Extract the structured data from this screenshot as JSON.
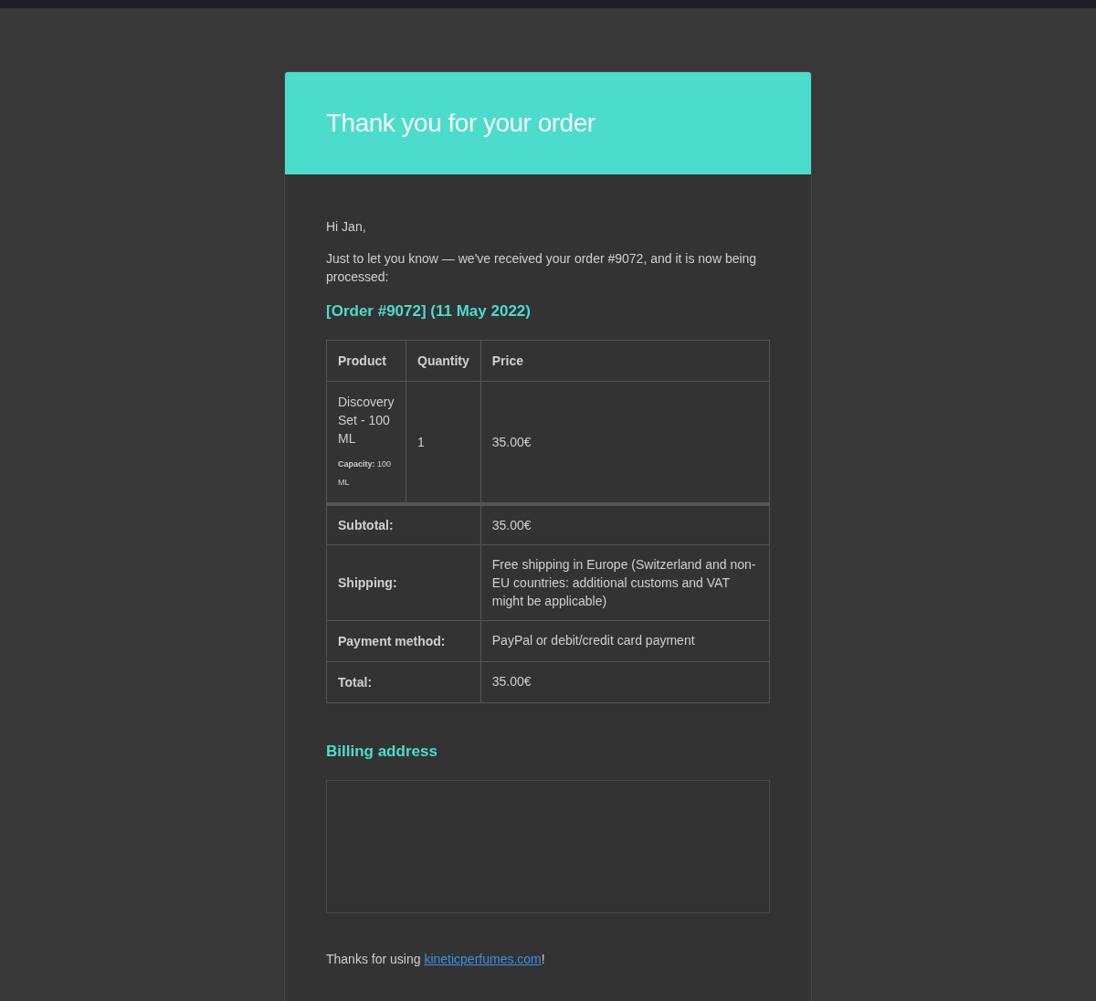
{
  "header": {
    "title": "Thank you for your order"
  },
  "greeting": "Hi Jan,",
  "intro": "Just to let you know — we've received your order #9072, and it is now being processed:",
  "order_heading": "[Order #9072] (11 May 2022)",
  "order_table": {
    "columns": [
      "Product",
      "Quantity",
      "Price"
    ],
    "items": [
      {
        "product": "Discovery Set - 100 ML",
        "meta": "**Capacity:** 100 ML",
        "quantity": "1",
        "price": "35.00€"
      }
    ],
    "totals": [
      {
        "label": "Subtotal:",
        "value": "35.00€"
      },
      {
        "label": "Shipping:",
        "value": "Free shipping in Europe (Switzerland and non-EU countries: additional customs and VAT might be applicable)"
      },
      {
        "label": "Payment method:",
        "value": "PayPal or debit/credit card payment"
      },
      {
        "label": "Total:",
        "value": "35.00€"
      }
    ]
  },
  "billing_heading": "Billing address",
  "footer": {
    "prefix": "Thanks for using ",
    "link": "kineticperfumes.com",
    "suffix": "!"
  }
}
